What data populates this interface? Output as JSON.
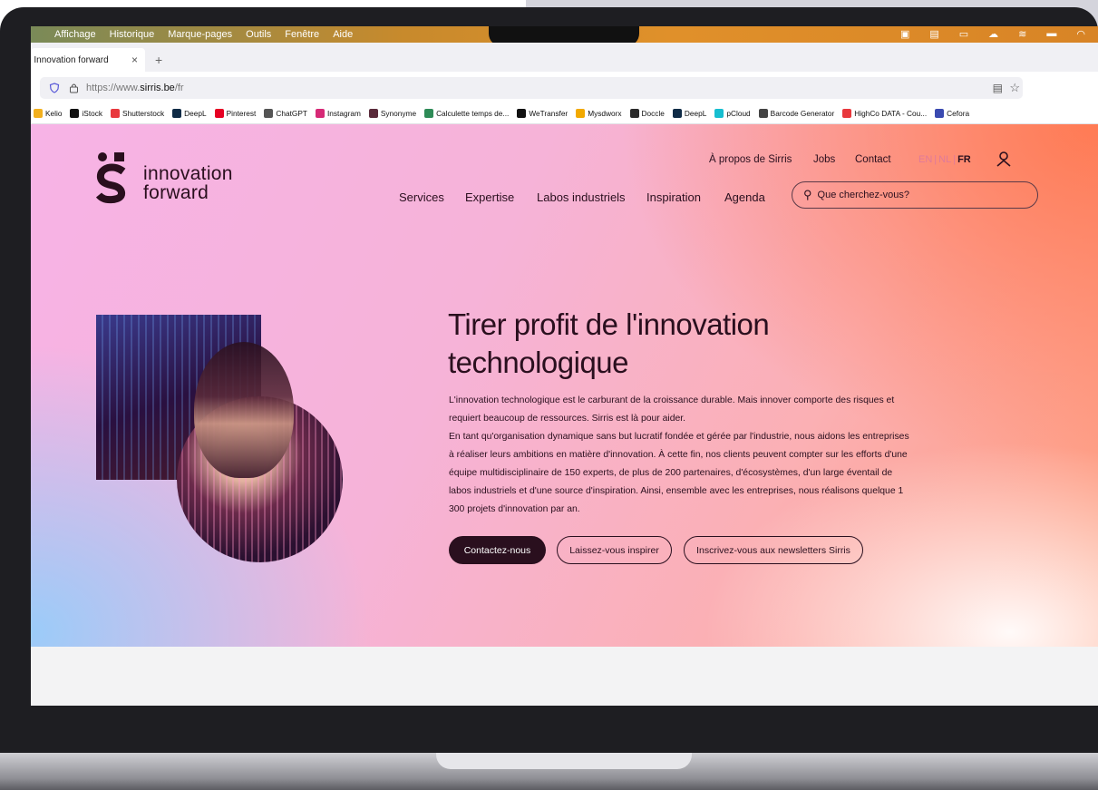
{
  "menubar": {
    "items": [
      "Affichage",
      "Historique",
      "Marque-pages",
      "Outils",
      "Fenêtre",
      "Aide"
    ]
  },
  "browser": {
    "tab_title": "| Innovation forward",
    "tab_close": "×",
    "new_tab": "+",
    "url_prefix": "https://www.",
    "url_domain": "sirris.be",
    "url_path": "/fr",
    "bookmarks": [
      {
        "label": "Kelio",
        "color": "#f2b01e"
      },
      {
        "label": "iStock",
        "color": "#111111"
      },
      {
        "label": "Shutterstock",
        "color": "#e8383d"
      },
      {
        "label": "DeepL",
        "color": "#0f2b46"
      },
      {
        "label": "Pinterest",
        "color": "#e60023"
      },
      {
        "label": "ChatGPT",
        "color": "#555555"
      },
      {
        "label": "Instagram",
        "color": "#d62976"
      },
      {
        "label": "Synonyme",
        "color": "#5a2a3a"
      },
      {
        "label": "Calculette temps de...",
        "color": "#2e8b57"
      },
      {
        "label": "WeTransfer",
        "color": "#111111"
      },
      {
        "label": "Mysdworx",
        "color": "#f2a900"
      },
      {
        "label": "Doccle",
        "color": "#2a2a2a"
      },
      {
        "label": "DeepL",
        "color": "#0f2b46"
      },
      {
        "label": "pCloud",
        "color": "#17bed0"
      },
      {
        "label": "Barcode Generator",
        "color": "#444444"
      },
      {
        "label": "HighCo DATA - Cou...",
        "color": "#e8383d"
      },
      {
        "label": "Cefora",
        "color": "#3a4ab0"
      }
    ]
  },
  "site": {
    "logo_line1": "innovation",
    "logo_line2": "forward",
    "top_links": [
      "À propos de Sirris",
      "Jobs",
      "Contact"
    ],
    "lang": {
      "en": "EN",
      "nl": "NL",
      "fr": "FR",
      "sep": "|"
    },
    "main_nav": [
      "Services",
      "Expertise",
      "Labos industriels",
      "Inspiration",
      "Agenda"
    ],
    "search_placeholder": "Que cherchez-vous?",
    "hero": {
      "title": "Tirer profit de l'innovation technologique",
      "paragraph1": "L'innovation technologique est le carburant de la croissance durable. Mais innover comporte des risques et requiert beaucoup de ressources. Sirris est là pour aider.",
      "paragraph2": "En tant qu'organisation dynamique sans but lucratif fondée et gérée par l'industrie, nous aidons les entreprises à réaliser leurs ambitions en matière d'innovation. À cette fin, nos clients peuvent compter sur les efforts d'une équipe multidisciplinaire de 150 experts, de plus de 200 partenaires, d'écosystèmes, d'un large éventail de labos industriels et d'une source d'inspiration. Ainsi, ensemble avec les entreprises, nous réalisons quelque 1 300 projets d'innovation par an.",
      "buttons": {
        "contact": "Contactez-nous",
        "inspire": "Laissez-vous inspirer",
        "newsletter": "Inscrivez-vous aux newsletters Sirris"
      }
    }
  },
  "colors": {
    "brand_dark": "#2a0f1e",
    "accent_pink": "#e07a9a"
  }
}
